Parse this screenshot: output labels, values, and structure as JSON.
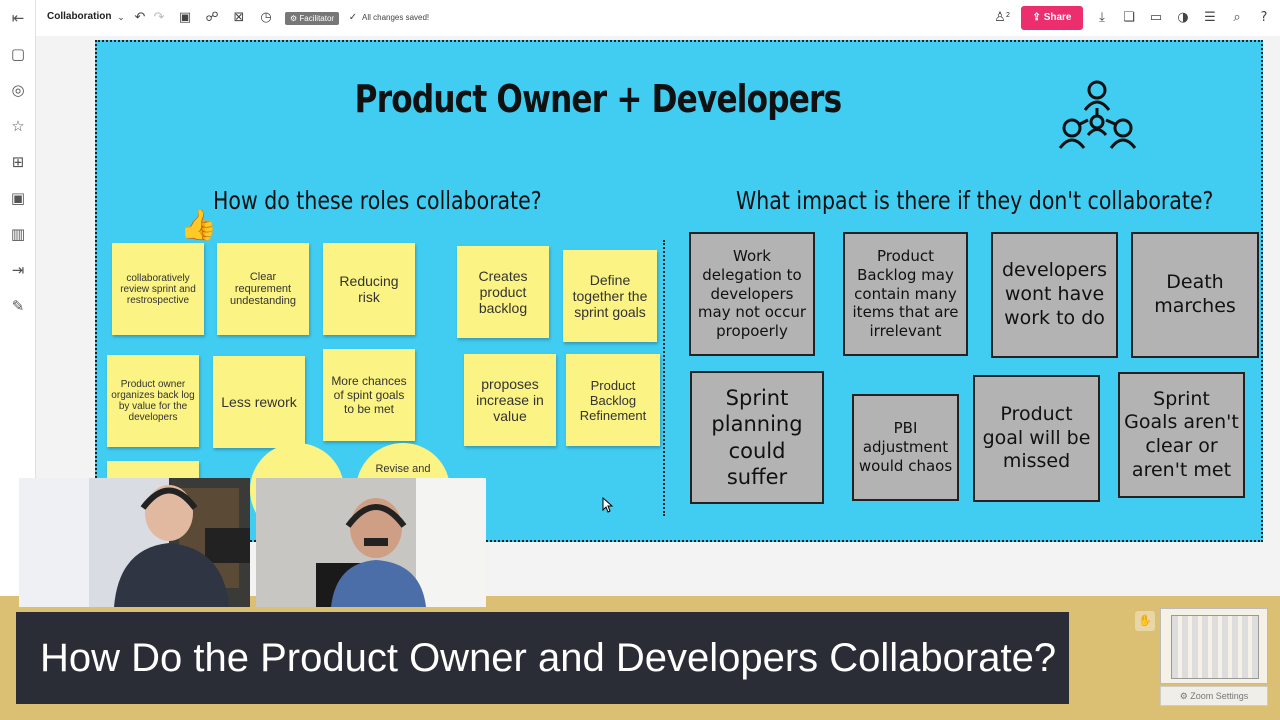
{
  "app": {
    "board_name": "Collaboration",
    "facilitator_badge": "Facilitator",
    "save_status": "All changes saved!",
    "users_count": "2",
    "share_label": "Share"
  },
  "board": {
    "title": "Product Owner + Developers",
    "left_heading": "How do these roles collaborate?",
    "right_heading": "What impact is there if they don't collaborate?",
    "left_stickies": [
      "collaboratively review sprint and restrospective",
      "Clear requrement undestanding",
      "Reducing risk",
      "Creates product backlog",
      "Define together the sprint goals",
      "Product owner organizes back log by value for the developers",
      "Less rework",
      "More chances of spint goals to be met",
      "proposes increase in value",
      "Product Backlog Refinement",
      "Revise and"
    ],
    "impact_cards": [
      "Work delegation to developers may not occur propoerly",
      "Product Backlog may contain many items that are irrelevant",
      "developers wont have work to do",
      "Death marches",
      "Sprint planning could suffer",
      "PBI adjustment would chaos",
      "Product goal will be missed",
      "Sprint Goals aren't clear or aren't met"
    ]
  },
  "caption": "How Do the Product Owner and Developers Collaborate?",
  "zoom_settings": "Zoom Settings",
  "colors": {
    "board_bg": "#41cdf2",
    "sticky_yellow": "#fbf383",
    "card_grey": "#b3b3b3",
    "share_pink": "#ec2e6f",
    "caption_bg": "#2a2d36",
    "strip_tan": "#dbbf72"
  }
}
